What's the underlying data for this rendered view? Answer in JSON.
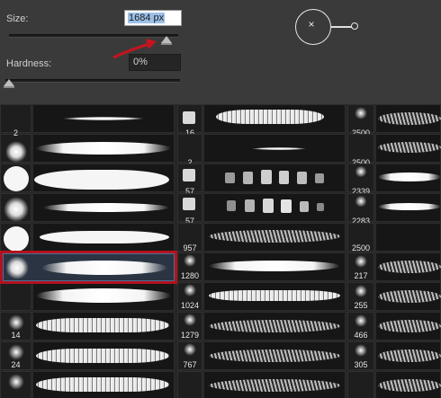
{
  "size": {
    "label": "Size:",
    "value": "1684 px"
  },
  "hardness": {
    "label": "Hardness:",
    "value": "0%"
  },
  "preview": {
    "glyph": "×"
  },
  "annotation": {
    "arrow_color": "#c4151f",
    "highlight_color": "#b2121d"
  },
  "brushes": {
    "col1": [
      "2",
      "",
      "",
      "",
      "",
      "",
      "14",
      "24",
      ""
    ],
    "col2": [
      "16",
      "2",
      "57",
      "57",
      "957",
      "1280",
      "1024",
      "1279",
      "767"
    ],
    "col3": [
      "2500",
      "2500",
      "2339",
      "2283",
      "2500",
      "217",
      "255",
      "466",
      "305"
    ]
  },
  "selected_brush": {
    "column": 1,
    "row": 5
  }
}
